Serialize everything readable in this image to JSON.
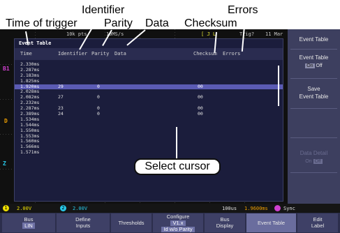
{
  "callouts": {
    "time_of_trigger": "Time of trigger",
    "identifier": "Identifier",
    "parity": "Parity",
    "data": "Data",
    "checksum": "Checksum",
    "errors": "Errors",
    "select_cursor": "Select cursor"
  },
  "topbar": {
    "timebase": "10k pts",
    "sample_rate": "10MS/s",
    "trigger_info": "[ J L",
    "trig_state": "Trig?",
    "date": "11 Mar"
  },
  "event_table": {
    "title": "Event Table",
    "columns": {
      "time": "Time",
      "identifier": "Identifier",
      "parity": "Parity",
      "data": "Data",
      "checksum": "Checksum",
      "errors": "Errors"
    },
    "rows": [
      {
        "time": "2.330ms",
        "id": "",
        "parity": "",
        "data": "",
        "checksum": ""
      },
      {
        "time": "2.287ms",
        "id": "",
        "parity": "",
        "data": "",
        "checksum": ""
      },
      {
        "time": "2.183ms",
        "id": "",
        "parity": "",
        "data": "",
        "checksum": ""
      },
      {
        "time": "1.825ms",
        "id": "",
        "parity": "",
        "data": "",
        "checksum": ""
      },
      {
        "time": "1.920ms",
        "id": "29",
        "parity": "0",
        "data": "",
        "checksum": "00",
        "selected": true
      },
      {
        "time": "2.028ms",
        "id": "",
        "parity": "",
        "data": "",
        "checksum": ""
      },
      {
        "time": "2.082ms",
        "id": "27",
        "parity": "0",
        "data": "",
        "checksum": "00"
      },
      {
        "time": "2.232ms",
        "id": "",
        "parity": "",
        "data": "",
        "checksum": ""
      },
      {
        "time": "2.287ms",
        "id": "23",
        "parity": "0",
        "data": "",
        "checksum": "00"
      },
      {
        "time": "2.389ms",
        "id": "24",
        "parity": "0",
        "data": "",
        "checksum": "00"
      },
      {
        "time": "1.534ms",
        "id": "",
        "parity": "",
        "data": "",
        "checksum": ""
      },
      {
        "time": "1.544ms",
        "id": "",
        "parity": "",
        "data": "",
        "checksum": ""
      },
      {
        "time": "1.550ms",
        "id": "",
        "parity": "",
        "data": "",
        "checksum": ""
      },
      {
        "time": "1.553ms",
        "id": "",
        "parity": "",
        "data": "",
        "checksum": ""
      },
      {
        "time": "1.560ms",
        "id": "",
        "parity": "",
        "data": "",
        "checksum": ""
      },
      {
        "time": "1.566ms",
        "id": "",
        "parity": "",
        "data": "",
        "checksum": ""
      },
      {
        "time": "1.571ms",
        "id": "",
        "parity": "",
        "data": "",
        "checksum": ""
      }
    ]
  },
  "markers": {
    "b1": "B1",
    "d": "D",
    "z": "Z"
  },
  "right_menu": {
    "event_table_header": "Event Table",
    "event_table_toggle_label": "Event Table",
    "on": "On",
    "off": "Off",
    "save_label1": "Save",
    "save_label2": "Event Table",
    "data_detail": "Data Detail",
    "data_detail_on": "On",
    "data_detail_off": "Off"
  },
  "status_bar": {
    "ch1_label": "1",
    "ch1_scale": "2.00V",
    "ch2_label": "2",
    "ch2_scale": "2.00V",
    "time_scale": "100us",
    "position": "1.9600ms",
    "source_label": "Sync"
  },
  "softkeys": {
    "bus_title": "Bus",
    "bus_value": "LIN",
    "define_inputs_1": "Define",
    "define_inputs_2": "Inputs",
    "thresholds": "Thresholds",
    "configure_1": "Configure",
    "configure_2": "V1.x",
    "configure_3": "Id w/o Parity",
    "bus_display_1": "Bus",
    "bus_display_2": "Display",
    "event_table": "Event Table",
    "edit_label_1": "Edit",
    "edit_label_2": "Label"
  },
  "colors": {
    "screen_bg": "#101010",
    "table_bg": "#1b1d3c",
    "selection": "#5b5bb4",
    "menu_bg": "#3d3f5f",
    "ch1_yellow": "#f0e000",
    "ch2_cyan": "#28c8e8",
    "bus_magenta": "#d040d0",
    "marker_orange": "#f0a000"
  }
}
